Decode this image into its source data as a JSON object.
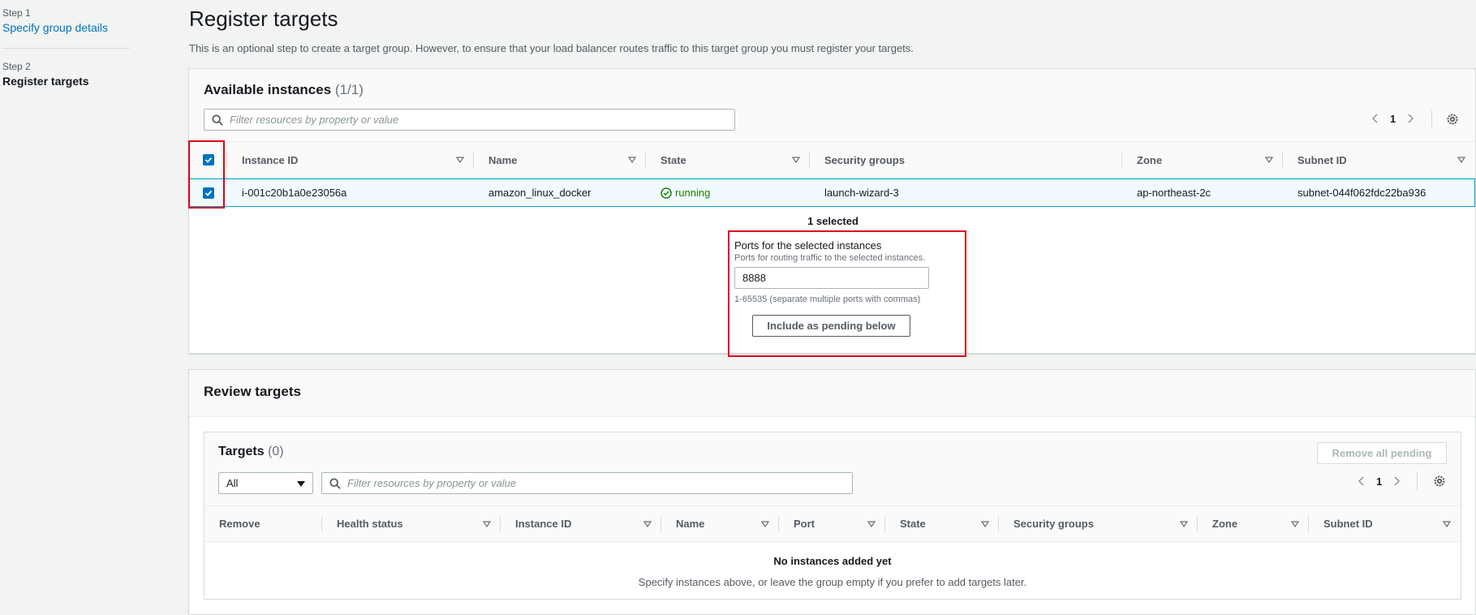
{
  "sidebar": {
    "step1_num": "Step 1",
    "step1_label": "Specify group details",
    "step2_num": "Step 2",
    "step2_label": "Register targets"
  },
  "header": {
    "title": "Register targets",
    "description": "This is an optional step to create a target group. However, to ensure that your load balancer routes traffic to this target group you must register your targets."
  },
  "available": {
    "title": "Available instances",
    "count": "(1/1)",
    "filter_placeholder": "Filter resources by property or value",
    "page": "1",
    "columns": [
      "Instance ID",
      "Name",
      "State",
      "Security groups",
      "Zone",
      "Subnet ID"
    ],
    "row": {
      "instance_id": "i-001c20b1a0e23056a",
      "name": "amazon_linux_docker",
      "state": "running",
      "security_groups": "launch-wizard-3",
      "zone": "ap-northeast-2c",
      "subnet_id": "subnet-044f062fdc22ba936"
    },
    "selected_text": "1 selected",
    "ports_label": "Ports for the selected instances",
    "ports_desc": "Ports for routing traffic to the selected instances.",
    "ports_value": "8888",
    "ports_hint": "1-65535 (separate multiple ports with commas)",
    "include_button": "Include as pending below"
  },
  "review": {
    "title": "Review targets",
    "targets_title": "Targets",
    "targets_count": "(0)",
    "remove_all_button": "Remove all pending",
    "select_value": "All",
    "filter_placeholder": "Filter resources by property or value",
    "page": "1",
    "columns": [
      "Remove",
      "Health status",
      "Instance ID",
      "Name",
      "Port",
      "State",
      "Security groups",
      "Zone",
      "Subnet ID"
    ],
    "empty_title": "No instances added yet",
    "empty_desc": "Specify instances above, or leave the group empty if you prefer to add targets later."
  },
  "colors": {
    "link": "#0073bb",
    "running": "#1d8102",
    "highlight": "#e0001a",
    "selected_row": "#f1faff"
  }
}
